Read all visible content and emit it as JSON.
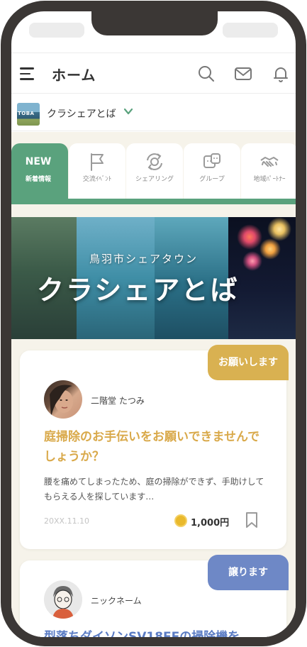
{
  "header": {
    "title": "ホーム",
    "icons": [
      "menu-icon",
      "search-icon",
      "mail-icon",
      "bell-icon"
    ]
  },
  "community": {
    "thumb_text": "TOBA",
    "name": "クラシェアとば"
  },
  "tabs": [
    {
      "badge": "NEW",
      "label": "新着情報",
      "icon": "new-badge",
      "active": true
    },
    {
      "label": "交流ｲﾍﾞﾝﾄ",
      "icon": "flag-icon",
      "active": false
    },
    {
      "label": "シェアリング",
      "icon": "share-cycle-icon",
      "active": false
    },
    {
      "label": "グループ",
      "icon": "group-icon",
      "active": false
    },
    {
      "label": "地域ﾊﾟｰﾄﾅｰ",
      "icon": "handshake-icon",
      "active": false
    }
  ],
  "banner": {
    "subtitle": "鳥羽市シェアタウン",
    "title": "クラシェアとば"
  },
  "posts": [
    {
      "badge": "お願いします",
      "author": "二階堂 たつみ",
      "title": "庭掃除のお手伝いをお願いできませんでしょうか？",
      "body": "腰を痛めてしまったため、庭の掃除ができず、手助けしてもらえる人を探しています…",
      "date": "20XX.11.10",
      "price": "1,000円"
    },
    {
      "badge": "譲ります",
      "author": "ニックネーム",
      "title": "型落ちダイソンSV18FFの掃除機を"
    }
  ],
  "colors": {
    "accent_green": "#5aa27d",
    "request_gold": "#d9b151",
    "give_blue": "#6e88c6",
    "frame": "#3b3735",
    "content_bg": "#f6f3ea"
  }
}
